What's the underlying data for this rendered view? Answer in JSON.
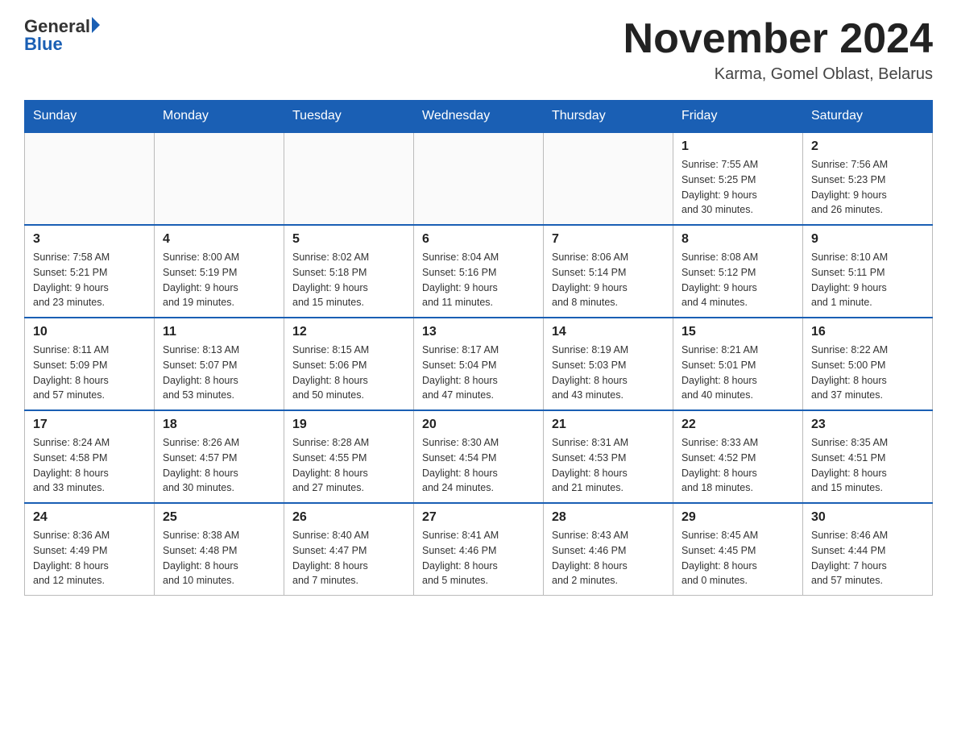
{
  "header": {
    "logo_general": "General",
    "logo_blue": "Blue",
    "month_title": "November 2024",
    "location": "Karma, Gomel Oblast, Belarus"
  },
  "days_of_week": [
    "Sunday",
    "Monday",
    "Tuesday",
    "Wednesday",
    "Thursday",
    "Friday",
    "Saturday"
  ],
  "weeks": [
    [
      {
        "day": "",
        "info": ""
      },
      {
        "day": "",
        "info": ""
      },
      {
        "day": "",
        "info": ""
      },
      {
        "day": "",
        "info": ""
      },
      {
        "day": "",
        "info": ""
      },
      {
        "day": "1",
        "info": "Sunrise: 7:55 AM\nSunset: 5:25 PM\nDaylight: 9 hours\nand 30 minutes."
      },
      {
        "day": "2",
        "info": "Sunrise: 7:56 AM\nSunset: 5:23 PM\nDaylight: 9 hours\nand 26 minutes."
      }
    ],
    [
      {
        "day": "3",
        "info": "Sunrise: 7:58 AM\nSunset: 5:21 PM\nDaylight: 9 hours\nand 23 minutes."
      },
      {
        "day": "4",
        "info": "Sunrise: 8:00 AM\nSunset: 5:19 PM\nDaylight: 9 hours\nand 19 minutes."
      },
      {
        "day": "5",
        "info": "Sunrise: 8:02 AM\nSunset: 5:18 PM\nDaylight: 9 hours\nand 15 minutes."
      },
      {
        "day": "6",
        "info": "Sunrise: 8:04 AM\nSunset: 5:16 PM\nDaylight: 9 hours\nand 11 minutes."
      },
      {
        "day": "7",
        "info": "Sunrise: 8:06 AM\nSunset: 5:14 PM\nDaylight: 9 hours\nand 8 minutes."
      },
      {
        "day": "8",
        "info": "Sunrise: 8:08 AM\nSunset: 5:12 PM\nDaylight: 9 hours\nand 4 minutes."
      },
      {
        "day": "9",
        "info": "Sunrise: 8:10 AM\nSunset: 5:11 PM\nDaylight: 9 hours\nand 1 minute."
      }
    ],
    [
      {
        "day": "10",
        "info": "Sunrise: 8:11 AM\nSunset: 5:09 PM\nDaylight: 8 hours\nand 57 minutes."
      },
      {
        "day": "11",
        "info": "Sunrise: 8:13 AM\nSunset: 5:07 PM\nDaylight: 8 hours\nand 53 minutes."
      },
      {
        "day": "12",
        "info": "Sunrise: 8:15 AM\nSunset: 5:06 PM\nDaylight: 8 hours\nand 50 minutes."
      },
      {
        "day": "13",
        "info": "Sunrise: 8:17 AM\nSunset: 5:04 PM\nDaylight: 8 hours\nand 47 minutes."
      },
      {
        "day": "14",
        "info": "Sunrise: 8:19 AM\nSunset: 5:03 PM\nDaylight: 8 hours\nand 43 minutes."
      },
      {
        "day": "15",
        "info": "Sunrise: 8:21 AM\nSunset: 5:01 PM\nDaylight: 8 hours\nand 40 minutes."
      },
      {
        "day": "16",
        "info": "Sunrise: 8:22 AM\nSunset: 5:00 PM\nDaylight: 8 hours\nand 37 minutes."
      }
    ],
    [
      {
        "day": "17",
        "info": "Sunrise: 8:24 AM\nSunset: 4:58 PM\nDaylight: 8 hours\nand 33 minutes."
      },
      {
        "day": "18",
        "info": "Sunrise: 8:26 AM\nSunset: 4:57 PM\nDaylight: 8 hours\nand 30 minutes."
      },
      {
        "day": "19",
        "info": "Sunrise: 8:28 AM\nSunset: 4:55 PM\nDaylight: 8 hours\nand 27 minutes."
      },
      {
        "day": "20",
        "info": "Sunrise: 8:30 AM\nSunset: 4:54 PM\nDaylight: 8 hours\nand 24 minutes."
      },
      {
        "day": "21",
        "info": "Sunrise: 8:31 AM\nSunset: 4:53 PM\nDaylight: 8 hours\nand 21 minutes."
      },
      {
        "day": "22",
        "info": "Sunrise: 8:33 AM\nSunset: 4:52 PM\nDaylight: 8 hours\nand 18 minutes."
      },
      {
        "day": "23",
        "info": "Sunrise: 8:35 AM\nSunset: 4:51 PM\nDaylight: 8 hours\nand 15 minutes."
      }
    ],
    [
      {
        "day": "24",
        "info": "Sunrise: 8:36 AM\nSunset: 4:49 PM\nDaylight: 8 hours\nand 12 minutes."
      },
      {
        "day": "25",
        "info": "Sunrise: 8:38 AM\nSunset: 4:48 PM\nDaylight: 8 hours\nand 10 minutes."
      },
      {
        "day": "26",
        "info": "Sunrise: 8:40 AM\nSunset: 4:47 PM\nDaylight: 8 hours\nand 7 minutes."
      },
      {
        "day": "27",
        "info": "Sunrise: 8:41 AM\nSunset: 4:46 PM\nDaylight: 8 hours\nand 5 minutes."
      },
      {
        "day": "28",
        "info": "Sunrise: 8:43 AM\nSunset: 4:46 PM\nDaylight: 8 hours\nand 2 minutes."
      },
      {
        "day": "29",
        "info": "Sunrise: 8:45 AM\nSunset: 4:45 PM\nDaylight: 8 hours\nand 0 minutes."
      },
      {
        "day": "30",
        "info": "Sunrise: 8:46 AM\nSunset: 4:44 PM\nDaylight: 7 hours\nand 57 minutes."
      }
    ]
  ]
}
